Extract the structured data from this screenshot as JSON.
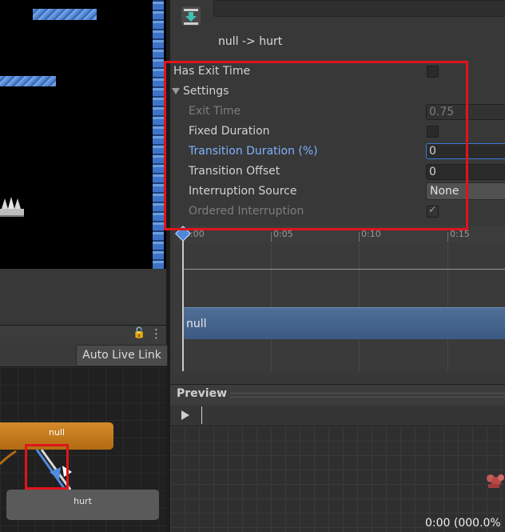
{
  "inspector": {
    "transition_title": "null -> hurt",
    "has_exit_time": {
      "label": "Has Exit Time",
      "checked": false
    },
    "settings_label": "Settings",
    "exit_time": {
      "label": "Exit Time",
      "value": "0.75"
    },
    "fixed_duration": {
      "label": "Fixed Duration",
      "checked": false
    },
    "transition_duration": {
      "label": "Transition Duration (%)",
      "value": "0"
    },
    "transition_offset": {
      "label": "Transition Offset",
      "value": "0"
    },
    "interruption_source": {
      "label": "Interruption Source",
      "value": "None"
    },
    "ordered_interruption": {
      "label": "Ordered Interruption",
      "checked": true,
      "check_glyph": "✓"
    }
  },
  "timeline": {
    "ticks": [
      "0:00",
      "0:05",
      "0:10",
      "0:15"
    ],
    "state_bar_label": "null"
  },
  "preview": {
    "title": "Preview",
    "time_readout": "0:00 (000.0%"
  },
  "animator": {
    "auto_live_link": "Auto Live Link",
    "state_null": "null",
    "state_hurt": "hurt"
  },
  "colors": {
    "highlight_red": "#e0141c",
    "state_orange": "#c27a1d",
    "active_blue": "#7fb2ff"
  }
}
